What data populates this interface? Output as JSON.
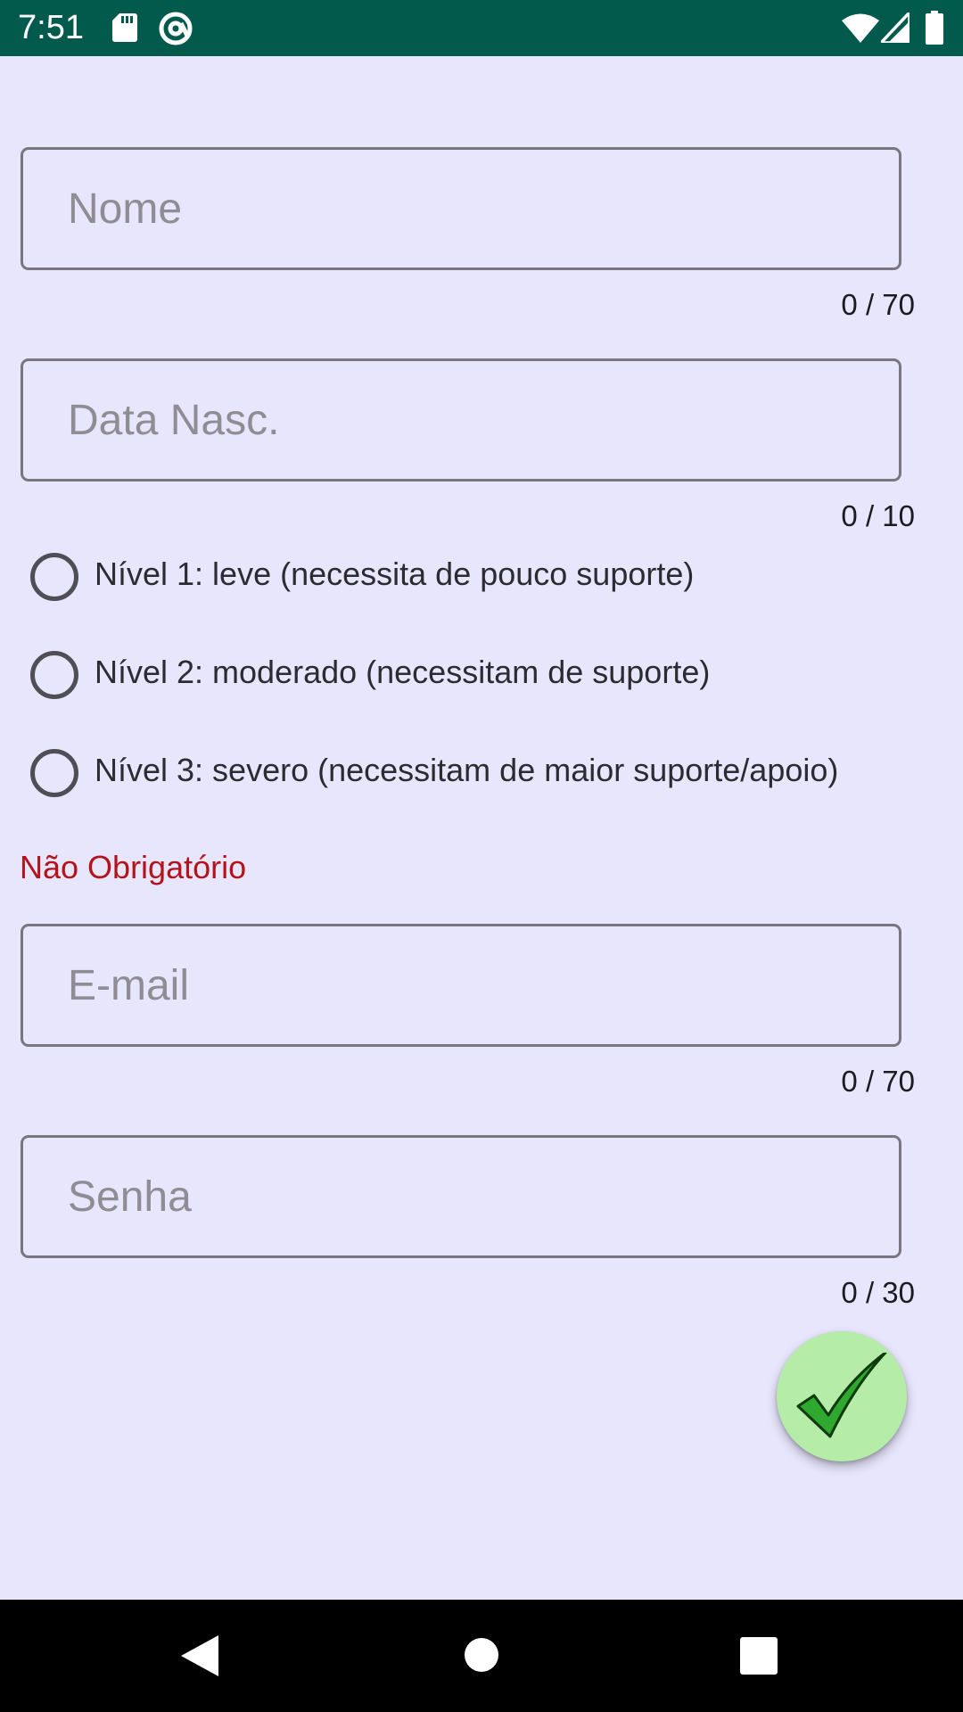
{
  "status_bar": {
    "time": "7:51",
    "background": "#015a4c",
    "left_icons": [
      "sd-card-icon",
      "at-sign-icon"
    ],
    "right_icons": [
      "wifi-icon",
      "cellular-signal-icon",
      "battery-icon"
    ]
  },
  "form": {
    "name_field": {
      "placeholder": "Nome",
      "value": "",
      "counter": "0 / 70"
    },
    "birthdate_field": {
      "placeholder": "Data Nasc.",
      "value": "",
      "counter": "0 / 10"
    },
    "level_options": [
      {
        "label": "Nível 1: leve (necessita de pouco suporte)",
        "selected": false
      },
      {
        "label": "Nível 2: moderado (necessitam de suporte)",
        "selected": false
      },
      {
        "label": "Nível 3: severo (necessitam de maior suporte/apoio)",
        "selected": false
      }
    ],
    "optional_label": "Não Obrigatório",
    "email_field": {
      "placeholder": "E-mail",
      "value": "",
      "counter": "0 / 70"
    },
    "password_field": {
      "placeholder": "Senha",
      "value": "",
      "counter": "0 / 30"
    }
  },
  "fab": {
    "icon": "checkmark-icon",
    "background": "#b5eca8"
  },
  "nav_bar": {
    "buttons": [
      "back-triangle-icon",
      "home-circle-icon",
      "recents-square-icon"
    ]
  },
  "colors": {
    "background": "#e8e6fd",
    "field_border": "#79767f",
    "optional_label": "#b3141c"
  }
}
